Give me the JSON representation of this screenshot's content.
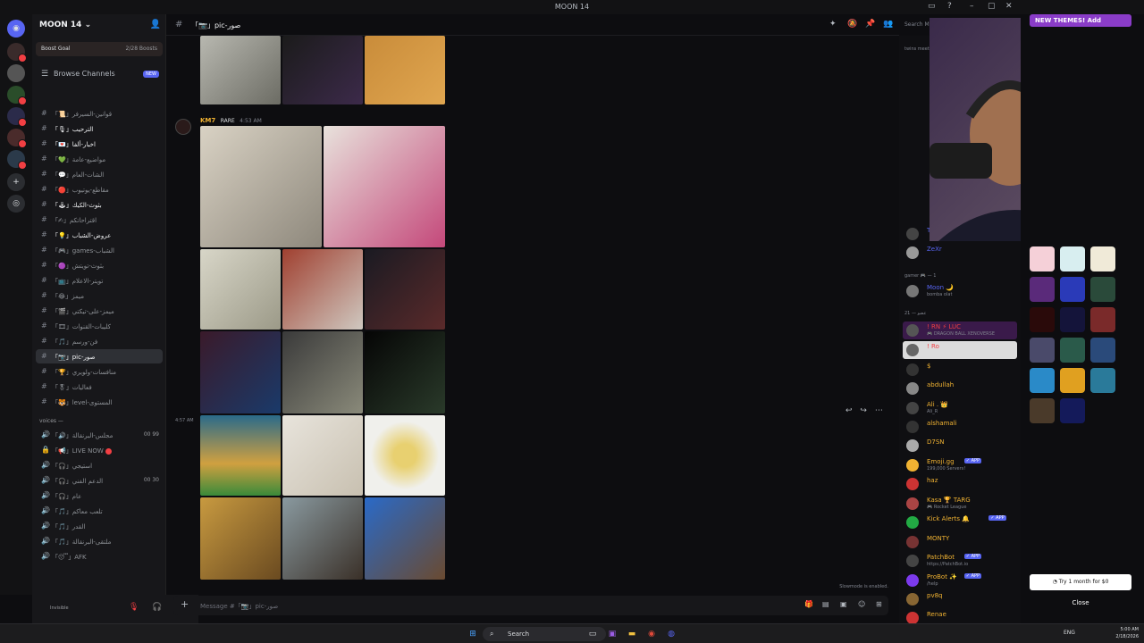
{
  "window": {
    "title": "MOON 14"
  },
  "server": {
    "name": "MOON 14",
    "boost_label": "Boost Goal",
    "boost_count": "2/28 Boosts",
    "browse_label": "Browse Channels",
    "browse_badge": "NEW"
  },
  "channels": [
    {
      "label": "「📜」قوانين-السيرفر"
    },
    {
      "label": "「🎙」الترحيب",
      "bold": true
    },
    {
      "label": "「💌」اخبار-ألفا",
      "bold": true
    },
    {
      "label": "「💚」مواضيع-عامة"
    },
    {
      "label": "「💬」الشات-العام"
    },
    {
      "label": "「🔴」مقاطع-يوتيوب"
    },
    {
      "label": "「🕹」بثوث-الكيك",
      "bold": true
    },
    {
      "label": "「✍」اقتراحاتكم"
    },
    {
      "label": "「💡」عروض-الشباب",
      "bold": true
    },
    {
      "label": "「🎮」games-الشباب"
    },
    {
      "label": "「🟣」بثوث-تويتش"
    },
    {
      "label": "「📺」تويتر-الاعلام"
    },
    {
      "label": "「😂」ميمز"
    },
    {
      "label": "「🎬」ميمز-على-تيكتي"
    },
    {
      "label": "「🎞」كليبات-القنوات"
    },
    {
      "label": "「🎵」فن-ورسم"
    },
    {
      "label": "「📷」pic-صور",
      "selected": true
    },
    {
      "label": "「🏆」منافسات-ولويري"
    },
    {
      "label": "「🎖」فعاليات"
    },
    {
      "label": "「🐯」level-المستوى"
    }
  ],
  "voices": {
    "category": "voices —",
    "items": [
      {
        "label": "「🔊」مجلس-البرنقالة",
        "right": "00 99"
      },
      {
        "label": "「📢」LIVE NOW",
        "live": true
      },
      {
        "label": "「🎧」استيجي"
      },
      {
        "label": "「🎧」الدعم الفني",
        "right": "00 30"
      },
      {
        "label": "「🎧」عام"
      },
      {
        "label": "「🎵」تلعب معاكم"
      },
      {
        "label": "「🎵」القدر"
      },
      {
        "label": "「🎵」ملتقى-البرنقالة"
      },
      {
        "label": "「😴」AFK"
      }
    ]
  },
  "user_panel": {
    "status": "Invisible"
  },
  "chat": {
    "channel_name": "「📷」pic-صور",
    "author": "KM7",
    "author_tag": "RARE",
    "timestamp": "4:53 AM",
    "timestamp2": "4:57 AM",
    "slowmode": "Slowmode is enabled.",
    "composer_placeholder": "Message #「📷」pic-صور"
  },
  "search": {
    "placeholder": "Search MOON 14"
  },
  "members": {
    "top_item": "twins meet",
    "section_gamer": "gamer 🎮 — 1",
    "section_21": "21 — عضو",
    "list": [
      {
        "name": "TITMR",
        "color": "#5865f2",
        "av": "#444"
      },
      {
        "name": "ZeXr",
        "color": "#5865f2",
        "av": "#999"
      },
      {
        "name": "Moon 🌙",
        "sub": "bomba olat",
        "color": "#5865f2",
        "av": "#777"
      },
      {
        "name": "! RN ⚡ LUC",
        "sub": "🎮 DRAGON BALL XENOVERSE",
        "color": "#f23f43",
        "av": "#555"
      },
      {
        "name": "! Ro",
        "color": "#f23f43",
        "av": "#666"
      },
      {
        "name": "$",
        "color": "#f0b232",
        "av": "#333"
      },
      {
        "name": "abdullah",
        "color": "#f0b232",
        "av": "#888"
      },
      {
        "name": "Ali . 👑",
        "sub": "Ali_R",
        "color": "#f0b232",
        "av": "#444"
      },
      {
        "name": "alshamali",
        "color": "#f0b232",
        "av": "#333"
      },
      {
        "name": "D7SN",
        "color": "#f0b232",
        "av": "#aaa"
      },
      {
        "name": "Emoji.gg",
        "sub": "199,000 Servers!",
        "color": "#f0b232",
        "app": true,
        "av": "#f0b232"
      },
      {
        "name": "haz",
        "color": "#f0b232",
        "av": "#c33"
      },
      {
        "name": "Kasa 🏆 TARG",
        "sub": "🎮 Rocket League",
        "color": "#f0b232",
        "av": "#a44"
      },
      {
        "name": "Kick Alerts 🔔",
        "color": "#f0b232",
        "app": true,
        "av": "#2a4"
      },
      {
        "name": "MONTY",
        "color": "#f0b232",
        "av": "#733"
      },
      {
        "name": "PatchBot",
        "sub": "https://PatchBot.io",
        "color": "#f0b232",
        "app": true,
        "av": "#444"
      },
      {
        "name": "ProBot ✨",
        "sub": "/help",
        "color": "#f0b232",
        "app": true,
        "av": "#7c3aed"
      },
      {
        "name": "pv8q",
        "color": "#f0b232",
        "av": "#863"
      },
      {
        "name": "Renae",
        "color": "#f0b232",
        "av": "#c33"
      }
    ]
  },
  "right_panel": {
    "new_themes": "NEW THEMES! Add",
    "try_label": "Try 1 month for $0",
    "close_label": "Close"
  },
  "taskbar": {
    "search": "Search",
    "lang": "ENG",
    "time": "5:00 AM",
    "date": "2/18/2026"
  }
}
